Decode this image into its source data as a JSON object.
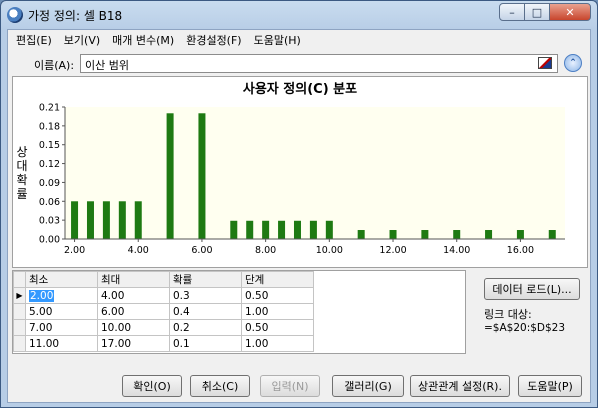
{
  "window": {
    "title": "가정 정의: 셀 B18"
  },
  "menu": [
    "편집(E)",
    "보기(V)",
    "매개 변수(M)",
    "환경설정(F)",
    "도움말(H)"
  ],
  "name": {
    "label": "이름(A):",
    "value": "이산 범위"
  },
  "chart_data": {
    "type": "bar",
    "title": "사용자 정의(C) 분포",
    "ylabel": "상대 확률",
    "xlabel": "",
    "xlim": [
      1.7,
      17.4
    ],
    "ylim": [
      0,
      0.21
    ],
    "yticks": [
      "0.21",
      "0.18",
      "0.15",
      "0.12",
      "0.09",
      "0.06",
      "0.03",
      "0.00"
    ],
    "ytick_values": [
      0.21,
      0.18,
      0.15,
      0.12,
      0.09,
      0.06,
      0.03,
      0.0
    ],
    "xticks": [
      "2.00",
      "4.00",
      "6.00",
      "8.00",
      "10.00",
      "12.00",
      "14.00",
      "16.00"
    ],
    "xtick_values": [
      2,
      4,
      6,
      8,
      10,
      12,
      14,
      16
    ],
    "x": [
      2.0,
      2.5,
      3.0,
      3.5,
      4.0,
      5.0,
      6.0,
      7.0,
      7.5,
      8.0,
      8.5,
      9.0,
      9.5,
      10.0,
      11.0,
      12.0,
      13.0,
      14.0,
      15.0,
      16.0,
      17.0
    ],
    "values": [
      0.06,
      0.06,
      0.06,
      0.06,
      0.06,
      0.2,
      0.2,
      0.029,
      0.029,
      0.029,
      0.029,
      0.029,
      0.029,
      0.029,
      0.0143,
      0.0143,
      0.0143,
      0.0143,
      0.0143,
      0.0143,
      0.0143
    ],
    "bar_color": "#1e7a12",
    "plot_background": "#fffff0"
  },
  "table": {
    "headers": [
      "최소",
      "최대",
      "확률",
      "단계"
    ],
    "rows": [
      [
        "2.00",
        "4.00",
        "0.3",
        "0.50"
      ],
      [
        "5.00",
        "6.00",
        "0.4",
        "1.00"
      ],
      [
        "7.00",
        "10.00",
        "0.2",
        "0.50"
      ],
      [
        "11.00",
        "17.00",
        "0.1",
        "1.00"
      ]
    ]
  },
  "side": {
    "load_button": "데이터 로드(L)...",
    "link_title": "링크 대상:",
    "link_value": "=$A$20:$D$23"
  },
  "buttons": {
    "ok": "확인(O)",
    "cancel": "취소(C)",
    "enter": "입력(N)",
    "gallery": "갤러리(G)",
    "correlate": "상관관계 설정(R).",
    "help": "도움말(P)"
  }
}
